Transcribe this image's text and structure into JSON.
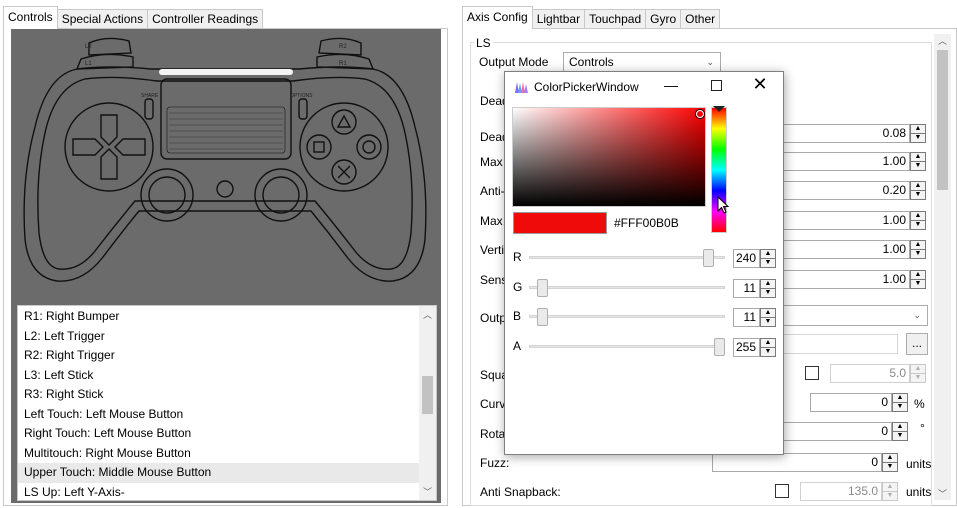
{
  "left_tabs": [
    "Controls",
    "Special Actions",
    "Controller Readings"
  ],
  "right_tabs": [
    "Axis Config",
    "Lightbar",
    "Touchpad",
    "Gyro",
    "Other"
  ],
  "controller": {
    "share": "SHARE",
    "options": "OPTIONS",
    "l2": "L2",
    "l1": "L1",
    "r2": "R2",
    "r1": "R1"
  },
  "mapping_list": [
    "R1: Right Bumper",
    "L2: Left Trigger",
    "R2: Right Trigger",
    "L3: Left Stick",
    "R3: Right Stick",
    "Left Touch: Left Mouse Button",
    "Right Touch: Left Mouse Button",
    "Multitouch: Right Mouse Button",
    "Upper Touch: Middle Mouse Button",
    "LS Up: Left Y-Axis-"
  ],
  "axis": {
    "group": "LS",
    "output_mode_label": "Output Mode",
    "output_mode_value": "Controls",
    "labels": [
      "Dead",
      "Dead",
      "Max",
      "Anti-",
      "Max",
      "Verti",
      "Sens",
      "Outp",
      "Squa",
      "Curv",
      "Rotat",
      "Fuzz:",
      "Anti Snapback:"
    ],
    "values": [
      "0.08",
      "1.00",
      "0.20",
      "1.00",
      "1.00",
      "1.00"
    ],
    "square_value": "5.0",
    "curve_value": "0",
    "curve_unit": "%",
    "rotation_value": "0",
    "rotation_unit": "°",
    "fuzz_value": "0",
    "fuzz_unit": "units",
    "snapback_value": "135.0",
    "snapback_unit": "units",
    "browse": "..."
  },
  "color_picker": {
    "title": "ColorPickerWindow",
    "hex": "#FFF00B0B",
    "preview_color": "#f00b0b",
    "channels": [
      {
        "name": "R",
        "value": "240",
        "fraction": 0.941
      },
      {
        "name": "G",
        "value": "11",
        "fraction": 0.043
      },
      {
        "name": "B",
        "value": "11",
        "fraction": 0.043
      },
      {
        "name": "A",
        "value": "255",
        "fraction": 1.0
      }
    ]
  }
}
